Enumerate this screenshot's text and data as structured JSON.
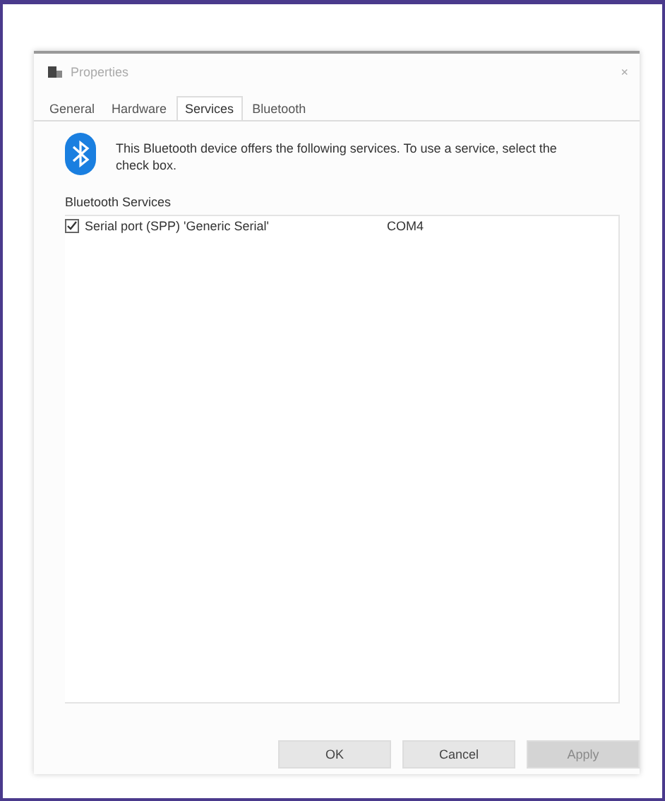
{
  "window": {
    "title": "Properties",
    "close": "×"
  },
  "tabs": [
    {
      "label": "General",
      "selected": false
    },
    {
      "label": "Hardware",
      "selected": false
    },
    {
      "label": "Services",
      "selected": true
    },
    {
      "label": "Bluetooth",
      "selected": false
    }
  ],
  "intro": "This Bluetooth device offers the following services. To use a service, select the check box.",
  "services_label": "Bluetooth Services",
  "services": [
    {
      "name": "Serial port (SPP) 'Generic Serial'",
      "port": "COM4",
      "checked": true
    }
  ],
  "buttons": [
    {
      "label": "OK",
      "disabled": false
    },
    {
      "label": "Cancel",
      "disabled": false
    },
    {
      "label": "Apply",
      "disabled": true
    }
  ]
}
